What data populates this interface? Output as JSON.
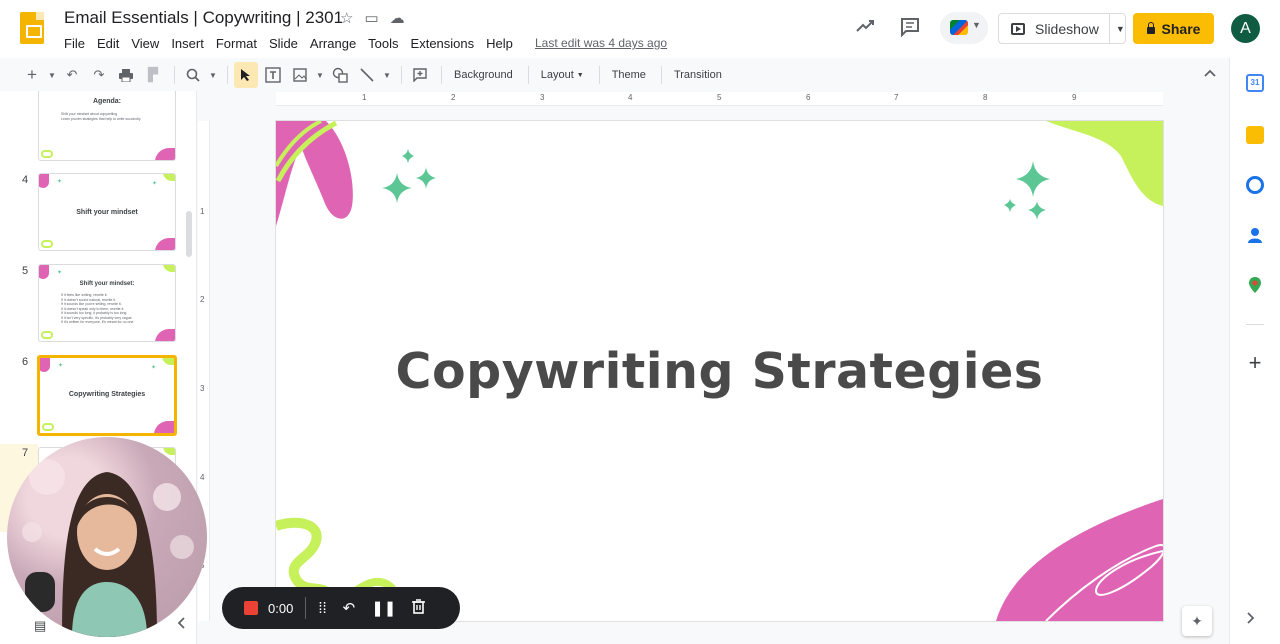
{
  "app": {
    "title": "Email Essentials | Copywriting | 2301",
    "last_edit": "Last edit was 4 days ago",
    "star_icon": "☆",
    "folder_icon": "▭",
    "cloud_icon": "☁"
  },
  "menu": [
    "File",
    "Edit",
    "View",
    "Insert",
    "Format",
    "Slide",
    "Arrange",
    "Tools",
    "Extensions",
    "Help"
  ],
  "top_actions": {
    "slideshow_label": "Slideshow",
    "share_label": "Share",
    "avatar_initial": "A"
  },
  "toolbar": {
    "background_label": "Background",
    "layout_label": "Layout",
    "theme_label": "Theme",
    "transition_label": "Transition"
  },
  "ruler": {
    "top": [
      "1",
      "2",
      "3",
      "4",
      "5",
      "6",
      "7",
      "8",
      "9"
    ],
    "left": [
      "1",
      "2",
      "3",
      "4",
      "5"
    ]
  },
  "slides": [
    {
      "number": "",
      "title": "Agenda:",
      "lines": [
        "Shift your mindset about copywriting",
        "Learn proven strategies that help to write succinctly"
      ]
    },
    {
      "number": "4",
      "title": "Shift your mindset",
      "lines": []
    },
    {
      "number": "5",
      "title": "Shift your mindset:",
      "lines": [
        "If it feels like writing, rewrite it.",
        "If it doesn't sound natural, rewrite it.",
        "If it sounds like you're selling, rewrite it.",
        "If it doesn't speak only to them, rewrite it.",
        "If it sounds too long, it probably is too long.",
        "If it isn't very specific, it's probably very vague.",
        "If it's written for everyone, it's meant for no one."
      ]
    },
    {
      "number": "6",
      "title": "Copywriting Strategies",
      "lines": []
    },
    {
      "number": "7",
      "title": "",
      "lines": []
    }
  ],
  "current_slide": {
    "title": "Copywriting Strategies"
  },
  "recorder": {
    "time": "0:00"
  },
  "colors": {
    "accent": "#fbbc04",
    "slide_pink": "#e064b4",
    "slide_green": "#c6f15b",
    "slide_teal": "#5cc795",
    "title_gray": "#4a4a4a"
  }
}
